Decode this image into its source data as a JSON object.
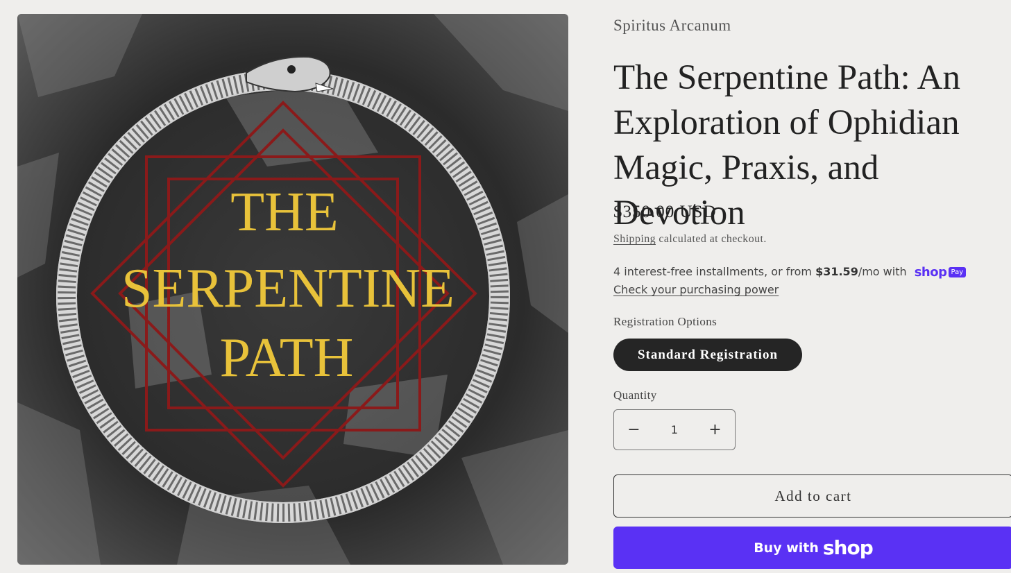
{
  "product_image": {
    "title_lines": [
      "THE",
      "SERPENTINE",
      "PATH"
    ],
    "colors": {
      "background": "#2a2a2a",
      "text_gold": "#e8c23a",
      "squares_red": "#8a1a1a",
      "serpent": "#bdbdbd"
    }
  },
  "vendor": "Spiritus Arcanum",
  "title": "The Serpentine Path: An Exploration of Ophidian Magic, Praxis, and Devotion",
  "price": "$350.00 USD",
  "tax_note": {
    "link": "Shipping",
    "rest": " calculated at checkout."
  },
  "installments": {
    "prefix": "4 interest-free installments, or from ",
    "amount": "$31.59",
    "suffix": "/mo with",
    "brand": "shop",
    "pay_badge": "Pay",
    "link": "Check your purchasing power"
  },
  "options": {
    "label": "Registration Options",
    "selected": "Standard Registration"
  },
  "quantity": {
    "label": "Quantity",
    "value": "1",
    "minus": "−",
    "plus": "+"
  },
  "buttons": {
    "add_to_cart": "Add to cart",
    "buy_with": "Buy with",
    "buy_brand": "shop"
  },
  "accent_color": "#5a31f4"
}
